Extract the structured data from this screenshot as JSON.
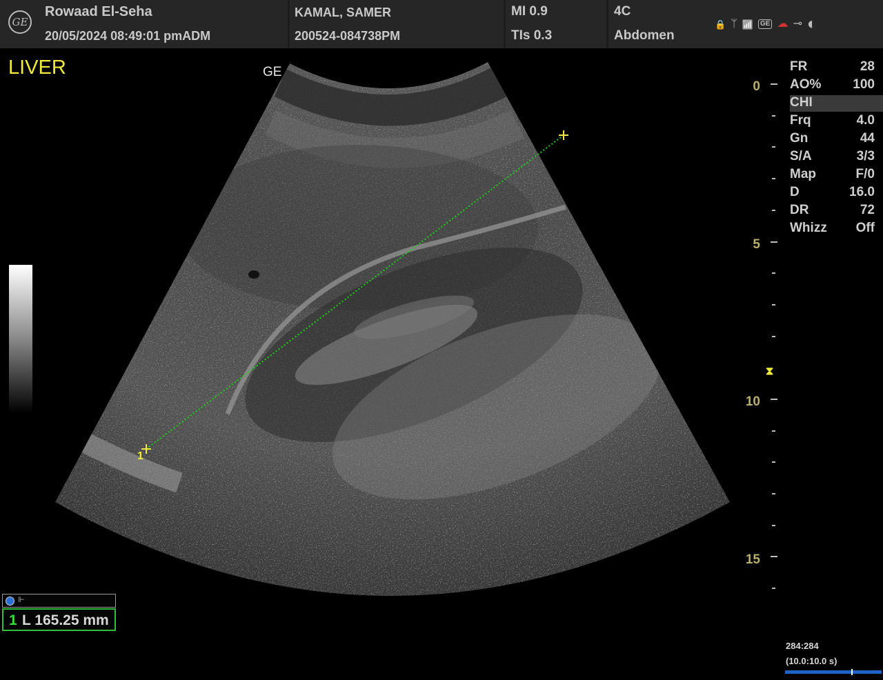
{
  "header": {
    "institution": "Rowaad El-Seha",
    "datetime": "20/05/2024 08:49:01 pmADM",
    "patient_name": "KAMAL, SAMER",
    "exam_id": "200524-084738PM",
    "mi": "MI 0.9",
    "tis": "TIs 0.3",
    "probe": "4C",
    "application": "Abdomen",
    "logo_text": "GE",
    "status_icons": [
      "lock-icon",
      "usb-icon",
      "wifi-icon",
      "ge-service-icon",
      "cloud-icon",
      "power-plug-icon",
      "contrast-icon"
    ],
    "status_glyphs": {
      "lock": "🔒",
      "usb": "ᛘ",
      "wifi": "📶",
      "ge": "GE",
      "cloud": "☁",
      "plug": "⊸",
      "contrast": "◐"
    }
  },
  "image": {
    "preset_label": "LIVER",
    "orientation_mark": "GE",
    "caliper_start_label": "1",
    "caliper_glyph": "+"
  },
  "depth_scale": {
    "labels": [
      "0",
      "5",
      "10",
      "15"
    ],
    "focus_marker": "⧗"
  },
  "params": [
    {
      "key": "FR",
      "value": "28"
    },
    {
      "key": "AO%",
      "value": "100"
    },
    {
      "key": "CHI",
      "value": ""
    },
    {
      "key": "Frq",
      "value": "4.0"
    },
    {
      "key": "Gn",
      "value": "44"
    },
    {
      "key": "S/A",
      "value": "3/3"
    },
    {
      "key": "Map",
      "value": "F/0"
    },
    {
      "key": "D",
      "value": "16.0"
    },
    {
      "key": "DR",
      "value": "72"
    },
    {
      "key": "Whizz",
      "value": "Off"
    }
  ],
  "measurement": {
    "index": "1",
    "result": "L  165.25 mm",
    "header_icon": "ruler-icon",
    "header_glyph": "⊩"
  },
  "cine": {
    "frames": "284:284",
    "time": "(10.0:10.0 s)"
  },
  "colors": {
    "preset": "#f2ea3a",
    "caliper_line": "#22cc22",
    "caliper_marker": "#f2ea3a",
    "measurement_border": "#2fbf3a",
    "cine_bar": "#1f63c8"
  }
}
